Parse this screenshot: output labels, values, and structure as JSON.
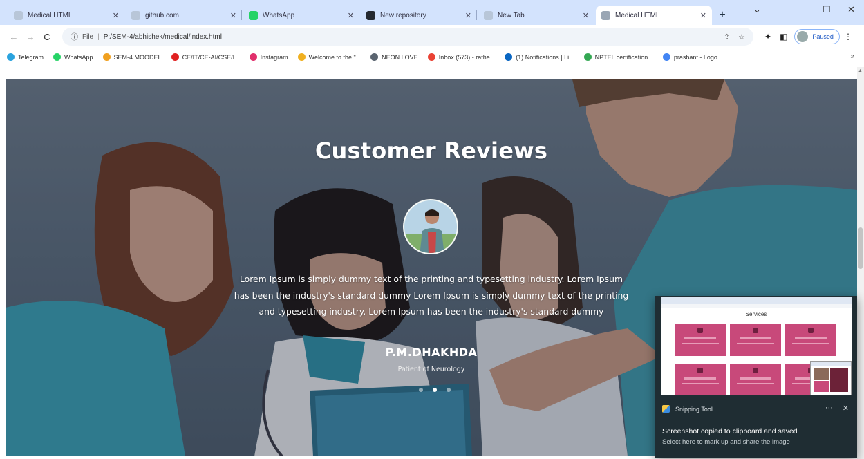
{
  "browser": {
    "tabs": [
      {
        "title": "Medical HTML",
        "favicon_color": "#b8c6d8",
        "active": false
      },
      {
        "title": "github.com",
        "favicon_color": "#b8c6d8",
        "active": false
      },
      {
        "title": "WhatsApp",
        "favicon_color": "#25d366",
        "active": false
      },
      {
        "title": "New repository",
        "favicon_color": "#24292f",
        "active": false
      },
      {
        "title": "New Tab",
        "favicon_color": "#b8c6d8",
        "active": false
      },
      {
        "title": "Medical HTML",
        "favicon_color": "#9aa6b4",
        "active": true
      }
    ],
    "new_tab_symbol": "+",
    "window_controls": {
      "dropdown": "⌄",
      "minimize": "—",
      "maximize": "☐",
      "close": "✕"
    },
    "nav": {
      "back": "←",
      "forward": "→",
      "reload": "C"
    },
    "address": {
      "prefix": "File",
      "separator": "|",
      "url": "P:/SEM-4/abhishek/medical/index.html",
      "info_icon": "ⓘ"
    },
    "toolbar_icons": {
      "share": "⇪",
      "star": "☆",
      "extensions": "✦",
      "sidebar": "◧",
      "menu": "⋮"
    },
    "profile_label": "Paused",
    "bookmarks": [
      {
        "label": "Telegram",
        "color": "#2aa3de"
      },
      {
        "label": "WhatsApp",
        "color": "#25d366"
      },
      {
        "label": "SEM-4 MOODEL",
        "color": "#f0a020"
      },
      {
        "label": "CE/IT/CE-AI/CSE/I...",
        "color": "#e02020"
      },
      {
        "label": "Instagram",
        "color": "#e1306c"
      },
      {
        "label": "Welcome to the \"...",
        "color": "#f0b020"
      },
      {
        "label": "NEON LOVE",
        "color": "#5a6470"
      },
      {
        "label": "Inbox (573) - rathe...",
        "color": "#ea4335"
      },
      {
        "label": "(1) Notifications | Li...",
        "color": "#0a66c2"
      },
      {
        "label": "NPTEL certification...",
        "color": "#34a853"
      },
      {
        "label": "prashant - Logo",
        "color": "#4285f4"
      }
    ],
    "bookmarks_more": "»"
  },
  "page": {
    "section_title": "Customer Reviews",
    "review_text": "Lorem Ipsum is simply dummy text of the printing and typesetting industry. Lorem Ipsum has been the industry's standard dummy Lorem Ipsum is simply dummy text of the printing and typesetting industry. Lorem Ipsum has been the industry's standard dummy",
    "reviewer_name": "P.M.DHAKHDA",
    "reviewer_role": "Patient of Neurology",
    "carousel_dots": 3,
    "carousel_active_index": 1
  },
  "snipping_toast": {
    "app_name": "Snipping Tool",
    "preview_title": "Services",
    "message": "Screenshot copied to clipboard and saved",
    "sub_message": "Select here to mark up and share the image",
    "more_symbol": "···",
    "close_symbol": "✕"
  }
}
